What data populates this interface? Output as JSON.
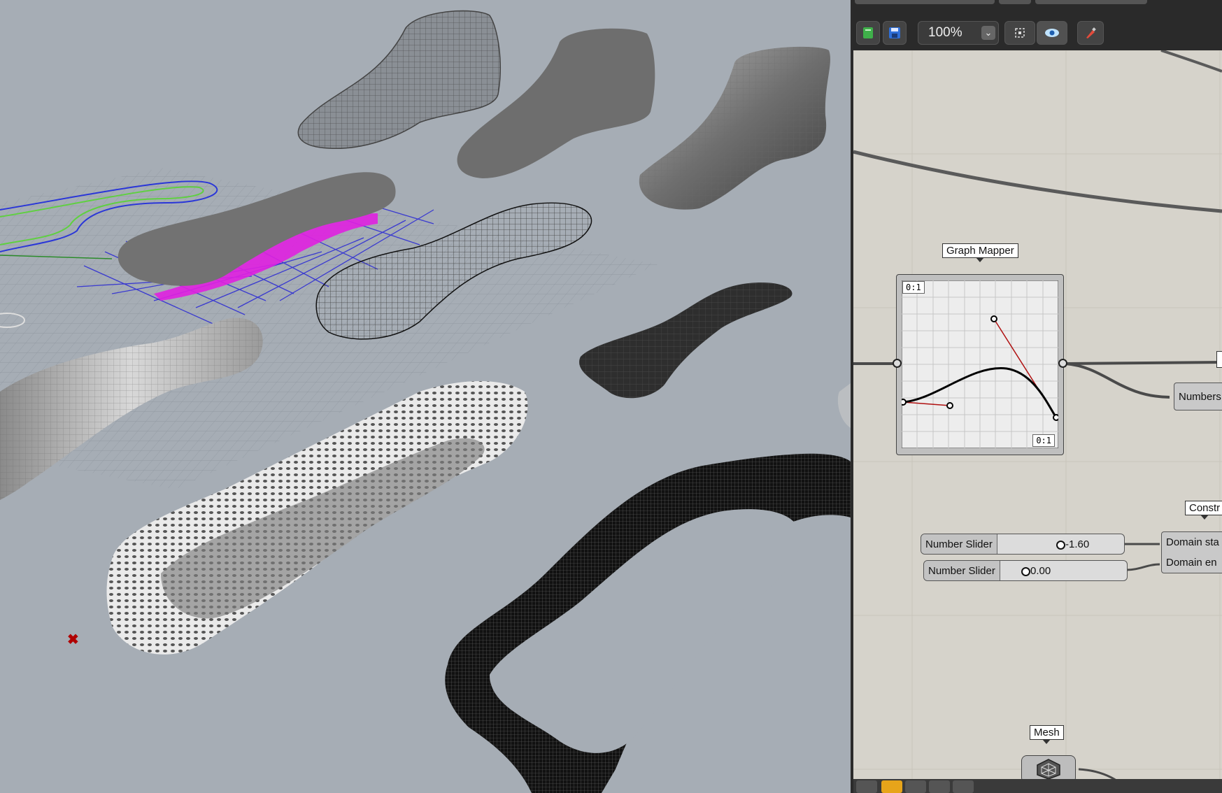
{
  "viewport": {
    "marker_icon": "x-mark-icon"
  },
  "toolbar": {
    "zoom_value": "100%",
    "zoom_dropdown_icon": "chevron-down-icon",
    "buttons": [
      "new-document-icon",
      "save-icon",
      "zoom-extents-icon",
      "preview-eye-icon",
      "paint-brush-icon"
    ]
  },
  "canvas": {
    "graph_mapper": {
      "tag": "Graph Mapper",
      "label_tl": "0:1",
      "label_br": "0:1"
    },
    "numbers_comp": {
      "label": "Numbers"
    },
    "construct_tag": {
      "label": "Constr"
    },
    "slider1": {
      "label": "Number Slider",
      "value": "-1.60"
    },
    "slider2": {
      "label": "Number Slider",
      "value": "0.00"
    },
    "domain": {
      "start": "Domain sta",
      "end": "Domain en"
    },
    "mesh": {
      "tag": "Mesh",
      "icon": "mesh-icon"
    }
  },
  "colors": {
    "viewport_bg": "#a6adb5",
    "canvas_bg": "#d6d3cb",
    "toolbar_bg": "#2a2a2a",
    "accent_magenta": "#e020e0",
    "graph_curve_red": "#b01010"
  }
}
